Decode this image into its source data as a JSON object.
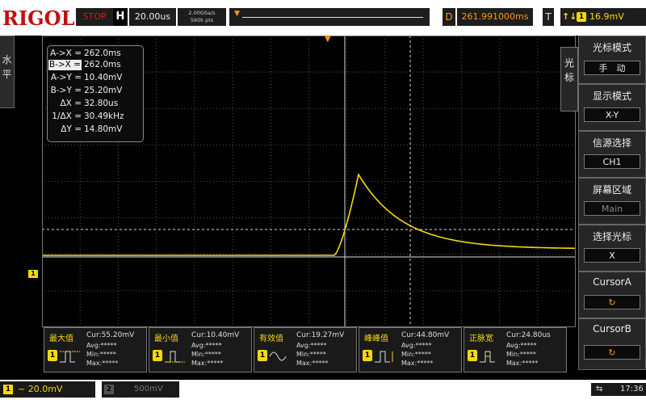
{
  "header": {
    "brand": "RIGOL",
    "run_state": "STOP",
    "horizontal_label": "H",
    "timebase": "20.00us",
    "sample_rate": "2.00GSa/s",
    "memory_depth": "560k pts",
    "delay_label": "D",
    "delay": "261.991000ms",
    "trigger_label": "T",
    "trigger_source": "1",
    "trigger_level": "16.9mV"
  },
  "left_panel": {
    "label": "水平"
  },
  "cursor_readout": {
    "rows": [
      {
        "label": "A->X =",
        "value": "262.0ms",
        "highlight": false
      },
      {
        "label": "B->X =",
        "value": "262.0ms",
        "highlight": true
      },
      {
        "label": "A->Y =",
        "value": "10.40mV",
        "highlight": false
      },
      {
        "label": "B->Y =",
        "value": "25.20mV",
        "highlight": false
      },
      {
        "label": "ΔX =",
        "value": "32.80us",
        "highlight": false
      },
      {
        "label": "1/ΔX =",
        "value": "30.49kHz",
        "highlight": false
      },
      {
        "label": "ΔY =",
        "value": "14.80mV",
        "highlight": false
      }
    ]
  },
  "channel_marker": "1",
  "side_key": {
    "label": "光标"
  },
  "menu": {
    "items": [
      {
        "title": "光标模式",
        "value": "手　动",
        "enabled": true
      },
      {
        "title": "显示模式",
        "value": "X-Y",
        "enabled": true
      },
      {
        "title": "信源选择",
        "value": "CH1",
        "enabled": true
      },
      {
        "title": "屏幕区域",
        "value": "Main",
        "enabled": false
      },
      {
        "title": "选择光标",
        "value": "X",
        "enabled": true
      },
      {
        "title": "CursorA",
        "value": "↻",
        "enabled": true
      },
      {
        "title": "CursorB",
        "value": "↻",
        "enabled": true
      }
    ]
  },
  "measurements": [
    {
      "name": "最大值",
      "cur": "Cur:55.20mV",
      "avg": "Avg:*****",
      "min": "Min:*****",
      "max": "Max:*****",
      "icon": "max-wave-icon"
    },
    {
      "name": "最小值",
      "cur": "Cur:10.40mV",
      "avg": "Avg:*****",
      "min": "Min:*****",
      "max": "Max:*****",
      "icon": "min-wave-icon"
    },
    {
      "name": "有效值",
      "cur": "Cur:19.27mV",
      "avg": "Avg:*****",
      "min": "Min:*****",
      "max": "Max:*****",
      "icon": "rms-wave-icon"
    },
    {
      "name": "峰峰值",
      "cur": "Cur:44.80mV",
      "avg": "Avg:*****",
      "min": "Min:*****",
      "max": "Max:*****",
      "icon": "vpp-wave-icon"
    },
    {
      "name": "正脉宽",
      "cur": "Cur:24.80us",
      "avg": "Avg:*****",
      "min": "Min:*****",
      "max": "Max:*****",
      "icon": "pwidth-wave-icon"
    }
  ],
  "footer": {
    "ch1": {
      "number": "1",
      "scale": "~ 20.0mV"
    },
    "ch2": {
      "number": "2",
      "scale": "500mV"
    },
    "time": "17:36",
    "usb": "⇆"
  },
  "colors": {
    "trace": "#f5d90a",
    "brand": "#c01010",
    "accent": "#ff9900",
    "grid": "#555555"
  }
}
